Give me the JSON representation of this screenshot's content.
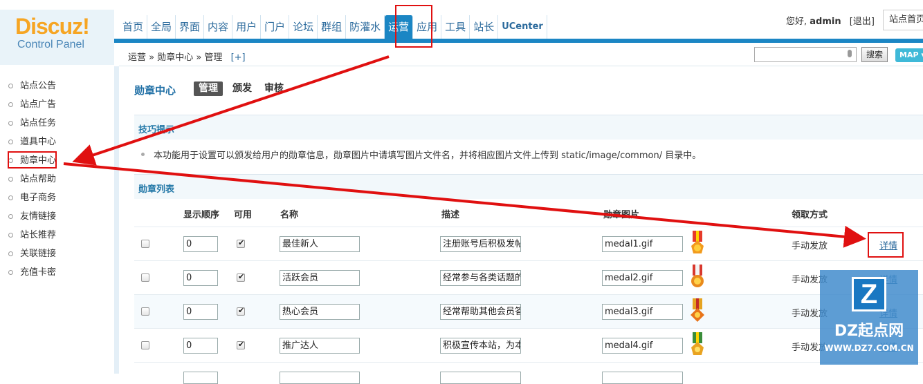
{
  "logo": {
    "main": "Discuz!",
    "sub": "Control Panel"
  },
  "nav": [
    "首页",
    "全局",
    "界面",
    "内容",
    "用户",
    "门户",
    "论坛",
    "群组",
    "防灌水",
    "运营",
    "应用",
    "工具",
    "站长",
    "UCenter"
  ],
  "nav_active": "运营",
  "user": {
    "greeting": "您好,",
    "name": "admin",
    "logout": "[退出]",
    "site_home": "站点首页"
  },
  "breadcrumb": {
    "path": "运营 » 勋章中心 » 管理",
    "add": "[+]"
  },
  "search": {
    "button": "搜索",
    "map": "MAP ▾"
  },
  "sidebar": [
    "站点公告",
    "站点广告",
    "站点任务",
    "道具中心",
    "勋章中心",
    "站点帮助",
    "电子商务",
    "友情链接",
    "站长推荐",
    "关联链接",
    "充值卡密"
  ],
  "sidebar_active": "勋章中心",
  "page": {
    "title": "勋章中心",
    "tabs": [
      "管理",
      "颁发",
      "审核"
    ],
    "current_tab": "管理"
  },
  "tips": {
    "title": "技巧提示",
    "text": "本功能用于设置可以颁发给用户的勋章信息，勋章图片中请填写图片文件名，并将相应图片文件上传到 static/image/common/ 目录中。"
  },
  "list": {
    "title": "勋章列表",
    "columns": [
      "显示顺序",
      "可用",
      "名称",
      "描述",
      "勋章图片",
      "领取方式"
    ],
    "rows": [
      {
        "order": "0",
        "enabled": true,
        "name": "最佳新人",
        "desc": "注册账号后积极发帖",
        "image": "medal1.gif",
        "method": "手动发放",
        "detail": "详情"
      },
      {
        "order": "0",
        "enabled": true,
        "name": "活跃会员",
        "desc": "经常参与各类话题的",
        "image": "medal2.gif",
        "method": "手动发放",
        "detail": "详情"
      },
      {
        "order": "0",
        "enabled": true,
        "name": "热心会员",
        "desc": "经常帮助其他会员答",
        "image": "medal3.gif",
        "method": "手动发放",
        "detail": "详情"
      },
      {
        "order": "0",
        "enabled": true,
        "name": "推广达人",
        "desc": "积极宣传本站，为本",
        "image": "medal4.gif",
        "method": "手动发放",
        "detail": "详情"
      }
    ]
  },
  "watermark": {
    "logo": "Z",
    "title": "DZ起点网",
    "url": "WWW.DZ7.COM.CN"
  },
  "colors": {
    "accent": "#1b86c4",
    "annotation": "#e01010"
  }
}
